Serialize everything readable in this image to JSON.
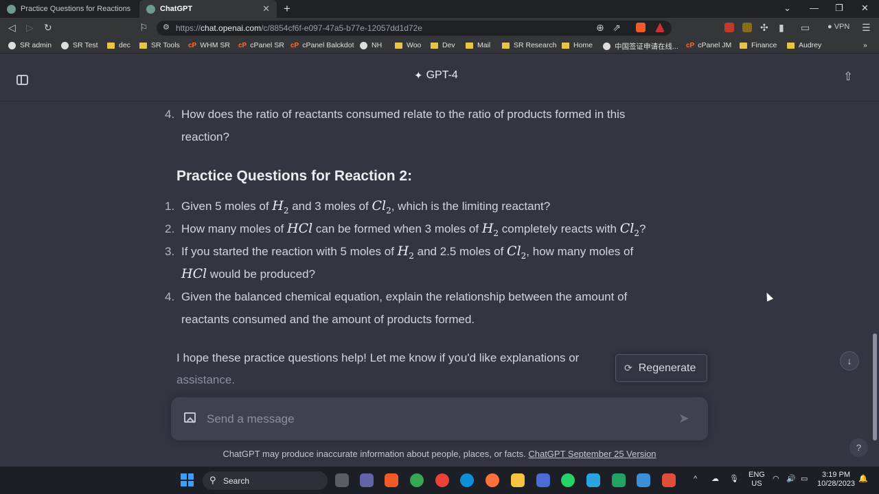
{
  "browser": {
    "tabs": [
      {
        "label": "Practice Questions for Reactions",
        "active": false
      },
      {
        "label": "ChatGPT",
        "active": true
      }
    ],
    "url_prefix": "https://",
    "url_host": "chat.openai.com",
    "url_path": "/c/8854cf6f-e097-47a5-b77e-12057dd1d72e",
    "vpn_label": "VPN",
    "bookmarks": [
      "SR admin",
      "SR Test",
      "dec",
      "SR Tools",
      "WHM SR",
      "cPanel SR",
      "cPanel Balckdot",
      "NH",
      "Woo",
      "Dev",
      "Mail",
      "SR Research",
      "Home",
      "中国签证申请在线...",
      "cPanel JM",
      "Finance",
      "Audrey"
    ]
  },
  "header": {
    "model": "GPT-4"
  },
  "conversation": {
    "prev_item": {
      "num": "4.",
      "line1": "How does the ratio of reactants consumed relate to the ratio of products formed in this",
      "line2": "reaction?"
    },
    "heading": "Practice Questions for Reaction 2:",
    "questions": [
      {
        "num": "1.",
        "a": "Given 5 moles of ",
        "m1": "H",
        "m1sub": "2",
        "b": " and 3 moles of ",
        "m2": "Cl",
        "m2sub": "2",
        "c": ", which is the limiting reactant?"
      },
      {
        "num": "2.",
        "a": "How many moles of ",
        "m1": "HCl",
        "b": " can be formed when 3 moles of ",
        "m2": "H",
        "m2sub": "2",
        "c": " completely reacts with ",
        "m3": "Cl",
        "m3sub": "2",
        "d": "?"
      },
      {
        "num": "3.",
        "a": "If you started the reaction with 5 moles of ",
        "m1": "H",
        "m1sub": "2",
        "b": " and 2.5 moles of ",
        "m2": "Cl",
        "m2sub": "2",
        "c": ", how many moles of",
        "m3": "HCl",
        "d": " would be produced?"
      },
      {
        "num": "4.",
        "line1": "Given the balanced chemical equation, explain the relationship between the amount of",
        "line2": "reactants consumed and the amount of products formed."
      }
    ],
    "closing_line1": "I hope these practice questions help! Let me know if you'd like explanations or",
    "closing_line2": "assistance."
  },
  "actions": {
    "regenerate": "Regenerate"
  },
  "composer": {
    "placeholder": "Send a message"
  },
  "footer": {
    "disclaimer": "ChatGPT may produce inaccurate information about people, places, or facts.",
    "version_link": "ChatGPT September 25 Version",
    "help": "?"
  },
  "taskbar": {
    "search": "Search",
    "lang_top": "ENG",
    "lang_bottom": "US",
    "time": "3:19 PM",
    "date": "10/28/2023"
  },
  "icons": [
    "sidebar-toggle-icon",
    "sparkle-icon",
    "share-icon",
    "image-upload-icon",
    "send-icon",
    "regenerate-icon",
    "arrow-down-icon",
    "help-icon"
  ]
}
